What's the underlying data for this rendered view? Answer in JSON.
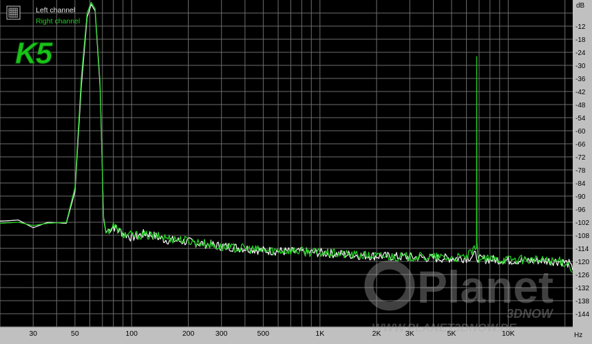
{
  "legend": {
    "left_label": "Left channel",
    "right_label": "Right channel",
    "icon": "legend-grid-icon"
  },
  "badge": {
    "text": "K5",
    "color": "#18c418"
  },
  "watermark": {
    "brand": "Planet",
    "sub": "3DNOW",
    "url": "WWW.PLANET3DNOW.DE"
  },
  "colors": {
    "background": "#000000",
    "grid": "#6e6e6e",
    "left": "#f0f0f0",
    "right": "#22d022",
    "frame": "#c0c0c0"
  },
  "chart_data": {
    "type": "line",
    "x_scale": "log",
    "xlim": [
      20,
      22000
    ],
    "ylim": [
      -150,
      0
    ],
    "xlabel": "Hz",
    "ylabel": "dB",
    "x_ticks": [
      {
        "value": 30,
        "label": "30"
      },
      {
        "value": 50,
        "label": "50"
      },
      {
        "value": 100,
        "label": "100"
      },
      {
        "value": 200,
        "label": "200"
      },
      {
        "value": 300,
        "label": "300"
      },
      {
        "value": 500,
        "label": "500"
      },
      {
        "value": 1000,
        "label": "1K"
      },
      {
        "value": 2000,
        "label": "2K"
      },
      {
        "value": 3000,
        "label": "3K"
      },
      {
        "value": 5000,
        "label": "5K"
      },
      {
        "value": 10000,
        "label": "10K"
      }
    ],
    "y_ticks": [
      -12,
      -18,
      -24,
      -30,
      -36,
      -42,
      -48,
      -54,
      -60,
      -66,
      -72,
      -78,
      -84,
      -90,
      -96,
      -102,
      -108,
      -114,
      -120,
      -126,
      -132,
      -138,
      -144
    ],
    "grid": true,
    "legend_position": "top-left",
    "series": [
      {
        "name": "Left channel",
        "color": "#f0f0f0",
        "points": [
          [
            20,
            -101.5
          ],
          [
            25,
            -101
          ],
          [
            30,
            -104.5
          ],
          [
            36,
            -102
          ],
          [
            45,
            -102.5
          ],
          [
            50,
            -88
          ],
          [
            54,
            -40
          ],
          [
            58,
            -8
          ],
          [
            61,
            -2
          ],
          [
            64,
            -5
          ],
          [
            68,
            -40
          ],
          [
            71,
            -100
          ],
          [
            73,
            -106.5
          ],
          [
            80,
            -104
          ],
          [
            90,
            -107
          ],
          [
            100,
            -109
          ],
          [
            120,
            -107
          ],
          [
            150,
            -110
          ],
          [
            200,
            -111
          ],
          [
            250,
            -112
          ],
          [
            300,
            -113
          ],
          [
            400,
            -114
          ],
          [
            500,
            -115
          ],
          [
            700,
            -115.5
          ],
          [
            1000,
            -116
          ],
          [
            1500,
            -117
          ],
          [
            2000,
            -117.5
          ],
          [
            3000,
            -118
          ],
          [
            4000,
            -118.5
          ],
          [
            5000,
            -118.5
          ],
          [
            6000,
            -118.5
          ],
          [
            6700,
            -117
          ],
          [
            7000,
            -119
          ],
          [
            8000,
            -119
          ],
          [
            10000,
            -119.5
          ],
          [
            15000,
            -119.5
          ],
          [
            19000,
            -120
          ],
          [
            21000,
            -121
          ],
          [
            22000,
            -124
          ]
        ]
      },
      {
        "name": "Right channel",
        "color": "#22d022",
        "points": [
          [
            20,
            -102.5
          ],
          [
            25,
            -102
          ],
          [
            30,
            -103.5
          ],
          [
            36,
            -102.5
          ],
          [
            45,
            -102
          ],
          [
            50,
            -86
          ],
          [
            54,
            -36
          ],
          [
            58,
            -6
          ],
          [
            61,
            -1
          ],
          [
            64,
            -4
          ],
          [
            68,
            -38
          ],
          [
            71,
            -101
          ],
          [
            73,
            -107
          ],
          [
            80,
            -103.5
          ],
          [
            90,
            -107.5
          ],
          [
            100,
            -108
          ],
          [
            120,
            -108
          ],
          [
            150,
            -109
          ],
          [
            200,
            -110.5
          ],
          [
            250,
            -112
          ],
          [
            300,
            -113.5
          ],
          [
            400,
            -114
          ],
          [
            500,
            -115
          ],
          [
            700,
            -115
          ],
          [
            1000,
            -116
          ],
          [
            1500,
            -117
          ],
          [
            2000,
            -117.5
          ],
          [
            3000,
            -118
          ],
          [
            4000,
            -118
          ],
          [
            5000,
            -118.5
          ],
          [
            6000,
            -118
          ],
          [
            6780,
            -114
          ],
          [
            6800,
            -26
          ],
          [
            6820,
            -113
          ],
          [
            7000,
            -119
          ],
          [
            8000,
            -119
          ],
          [
            10000,
            -119
          ],
          [
            15000,
            -119.5
          ],
          [
            19000,
            -120
          ],
          [
            21000,
            -121
          ],
          [
            22000,
            -125
          ]
        ]
      }
    ]
  }
}
